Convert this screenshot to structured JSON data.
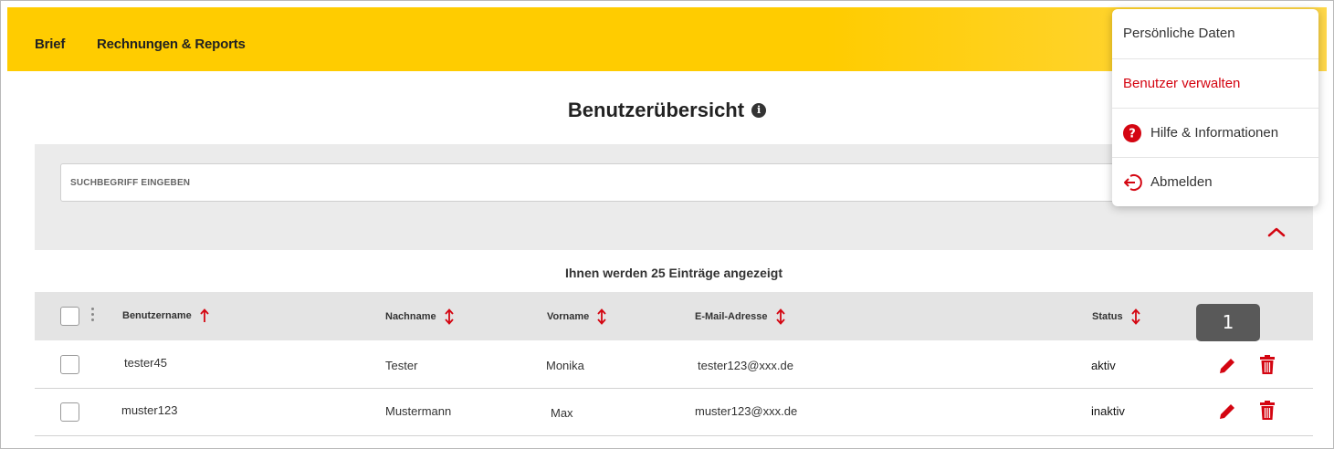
{
  "nav": {
    "brief": "Brief",
    "reports": "Rechnungen & Reports"
  },
  "page": {
    "title": "Benutzerübersicht",
    "info_glyph": "i"
  },
  "search": {
    "placeholder": "SUCHBEGRIFF EINGEBEN",
    "value": ""
  },
  "results": {
    "count_text": "Ihnen werden 25 Einträge angezeigt"
  },
  "table": {
    "columns": [
      "Benutzername",
      "Nachname",
      "Vorname",
      "E-Mail-Adresse",
      "Status"
    ],
    "sort_icons": [
      "sort-ascending-icon",
      "sort-both-icon",
      "sort-both-icon",
      "sort-both-icon",
      "sort-both-icon"
    ],
    "rows": [
      {
        "username": "tester45",
        "lastname": "Tester",
        "firstname": "Monika",
        "email": "tester123@xxx.de",
        "status": "aktiv"
      },
      {
        "username": "muster123",
        "lastname": "Mustermann",
        "firstname": "Max",
        "email": "muster123@xxx.de",
        "status": "inaktiv"
      }
    ]
  },
  "annotation": {
    "badge": "1"
  },
  "menu": {
    "items": [
      {
        "label": "Persönliche Daten",
        "icon": ""
      },
      {
        "label": "Benutzer verwalten",
        "icon": ""
      },
      {
        "label": "Hilfe & Informationen",
        "icon": "help-circle-icon"
      },
      {
        "label": "Abmelden",
        "icon": "logout-icon"
      }
    ],
    "help_glyph": "?"
  },
  "colors": {
    "brand_yellow": "#ffcc00",
    "accent_red": "#d40511"
  }
}
